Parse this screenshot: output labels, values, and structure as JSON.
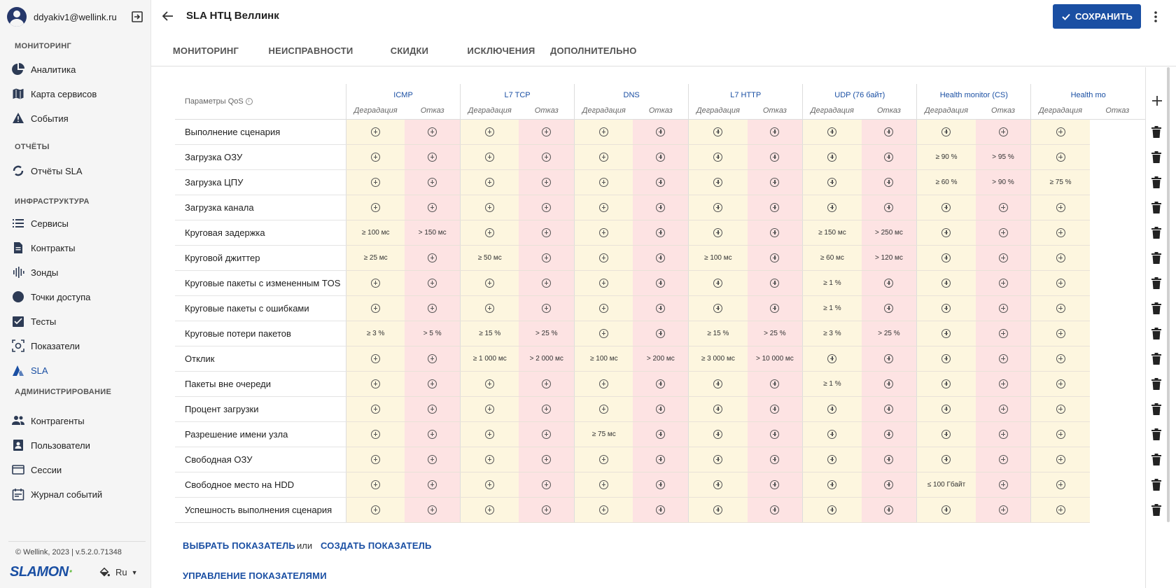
{
  "user": {
    "email": "ddyakiv1@wellink.ru"
  },
  "sidebar": {
    "sections": [
      {
        "title": "МОНИТОРИНГ",
        "items": [
          {
            "label": "Аналитика",
            "icon": "pie-chart-icon"
          },
          {
            "label": "Карта сервисов",
            "icon": "map-icon"
          },
          {
            "label": "События",
            "icon": "warning-icon"
          }
        ]
      },
      {
        "title": "ОТЧЁТЫ",
        "items": [
          {
            "label": "Отчёты SLA",
            "icon": "sync-icon"
          }
        ]
      },
      {
        "title": "ИНФРАСТРУКТУРА",
        "items": [
          {
            "label": "Сервисы",
            "icon": "list-icon"
          },
          {
            "label": "Контракты",
            "icon": "document-icon"
          },
          {
            "label": "Зонды",
            "icon": "probe-icon"
          },
          {
            "label": "Точки доступа",
            "icon": "circle-icon"
          },
          {
            "label": "Тесты",
            "icon": "checklist-icon"
          },
          {
            "label": "Показатели",
            "icon": "metrics-icon"
          },
          {
            "label": "SLA",
            "icon": "sla-icon",
            "active": true
          }
        ]
      },
      {
        "title": "АДМИНИСТРИРОВАНИЕ",
        "items": [
          {
            "label": "Контрагенты",
            "icon": "people-icon"
          },
          {
            "label": "Пользователи",
            "icon": "user-card-icon"
          },
          {
            "label": "Сессии",
            "icon": "window-icon"
          },
          {
            "label": "Журнал событий",
            "icon": "calendar-icon"
          }
        ]
      }
    ],
    "copyright": "© Wellink, 2023 | v.5.2.0.71348",
    "logo": "SLAMON",
    "language": "Ru"
  },
  "header": {
    "title": "SLA НТЦ Веллинк",
    "save_label": "СОХРАНИТЬ"
  },
  "tabs": [
    {
      "label": "МОНИТОРИНГ",
      "active": true
    },
    {
      "label": "НЕИСПРАВНОСТИ"
    },
    {
      "label": "СКИДКИ"
    },
    {
      "label": "ИСКЛЮЧЕНИЯ"
    },
    {
      "label": "ДОПОЛНИТЕЛЬНО"
    }
  ],
  "table": {
    "qos_header": "Параметры QoS",
    "sub_headers": {
      "degradation": "Деградация",
      "failure": "Отказ"
    },
    "groups": [
      "ICMP",
      "L7 TCP",
      "DNS",
      "L7 HTTP",
      "UDP (76 байт)",
      "Health monitor (CS)",
      "Health mo"
    ],
    "rows": [
      {
        "label": "Выполнение сценария",
        "cells": [
          "",
          "",
          "",
          "",
          "",
          "",
          "",
          "",
          "",
          "",
          "",
          "",
          ""
        ]
      },
      {
        "label": "Загрузка ОЗУ",
        "cells": [
          "",
          "",
          "",
          "",
          "",
          "",
          "",
          "",
          "",
          "",
          "≥ 90 %",
          "> 95 %",
          ""
        ]
      },
      {
        "label": "Загрузка ЦПУ",
        "cells": [
          "",
          "",
          "",
          "",
          "",
          "",
          "",
          "",
          "",
          "",
          "≥ 60 %",
          "> 90 %",
          "≥ 75 %"
        ]
      },
      {
        "label": "Загрузка канала",
        "cells": [
          "",
          "",
          "",
          "",
          "",
          "",
          "",
          "",
          "",
          "",
          "",
          "",
          ""
        ]
      },
      {
        "label": "Круговая задержка",
        "cells": [
          "≥ 100 мс",
          "> 150 мс",
          "",
          "",
          "",
          "",
          "",
          "",
          "≥ 150 мс",
          "> 250 мс",
          "",
          "",
          ""
        ]
      },
      {
        "label": "Круговой джиттер",
        "cells": [
          "≥ 25 мс",
          "",
          "≥ 50 мс",
          "",
          "",
          "",
          "≥ 100 мс",
          "",
          "≥ 60 мс",
          "> 120 мс",
          "",
          "",
          ""
        ]
      },
      {
        "label": "Круговые пакеты с измененным TOS",
        "cells": [
          "",
          "",
          "",
          "",
          "",
          "",
          "",
          "",
          "≥ 1 %",
          "",
          "",
          "",
          ""
        ]
      },
      {
        "label": "Круговые пакеты с ошибками",
        "cells": [
          "",
          "",
          "",
          "",
          "",
          "",
          "",
          "",
          "≥ 1 %",
          "",
          "",
          "",
          ""
        ]
      },
      {
        "label": "Круговые потери пакетов",
        "cells": [
          "≥ 3 %",
          "> 5 %",
          "≥ 15 %",
          "> 25 %",
          "",
          "",
          "≥ 15 %",
          "> 25 %",
          "≥ 3 %",
          "> 25 %",
          "",
          "",
          ""
        ]
      },
      {
        "label": "Отклик",
        "cells": [
          "",
          "",
          "≥ 1 000 мс",
          "> 2 000 мс",
          "≥ 100 мс",
          "> 200 мс",
          "≥ 3 000 мс",
          "> 10 000 мс",
          "",
          "",
          "",
          "",
          ""
        ]
      },
      {
        "label": "Пакеты вне очереди",
        "cells": [
          "",
          "",
          "",
          "",
          "",
          "",
          "",
          "",
          "≥ 1 %",
          "",
          "",
          "",
          ""
        ]
      },
      {
        "label": "Процент загрузки",
        "cells": [
          "",
          "",
          "",
          "",
          "",
          "",
          "",
          "",
          "",
          "",
          "",
          "",
          ""
        ]
      },
      {
        "label": "Разрешение имени узла",
        "cells": [
          "",
          "",
          "",
          "",
          "≥ 75 мс",
          "",
          "",
          "",
          "",
          "",
          "",
          "",
          ""
        ]
      },
      {
        "label": "Свободная ОЗУ",
        "cells": [
          "",
          "",
          "",
          "",
          "",
          "",
          "",
          "",
          "",
          "",
          "",
          "",
          ""
        ]
      },
      {
        "label": "Свободное место на HDD",
        "cells": [
          "",
          "",
          "",
          "",
          "",
          "",
          "",
          "",
          "",
          "",
          "≤ 100 Гбайт",
          "",
          ""
        ]
      },
      {
        "label": "Успешность выполнения сценария",
        "cells": [
          "",
          "",
          "",
          "",
          "",
          "",
          "",
          "",
          "",
          "",
          "",
          "",
          ""
        ]
      }
    ]
  },
  "bottom": {
    "choose_label": "ВЫБРАТЬ ПОКАЗАТЕЛЬ",
    "or_label": "или",
    "create_label": "СОЗДАТЬ ПОКАЗАТЕЛЬ",
    "manage_label": "УПРАВЛЕНИЕ ПОКАЗАТЕЛЯМИ"
  }
}
